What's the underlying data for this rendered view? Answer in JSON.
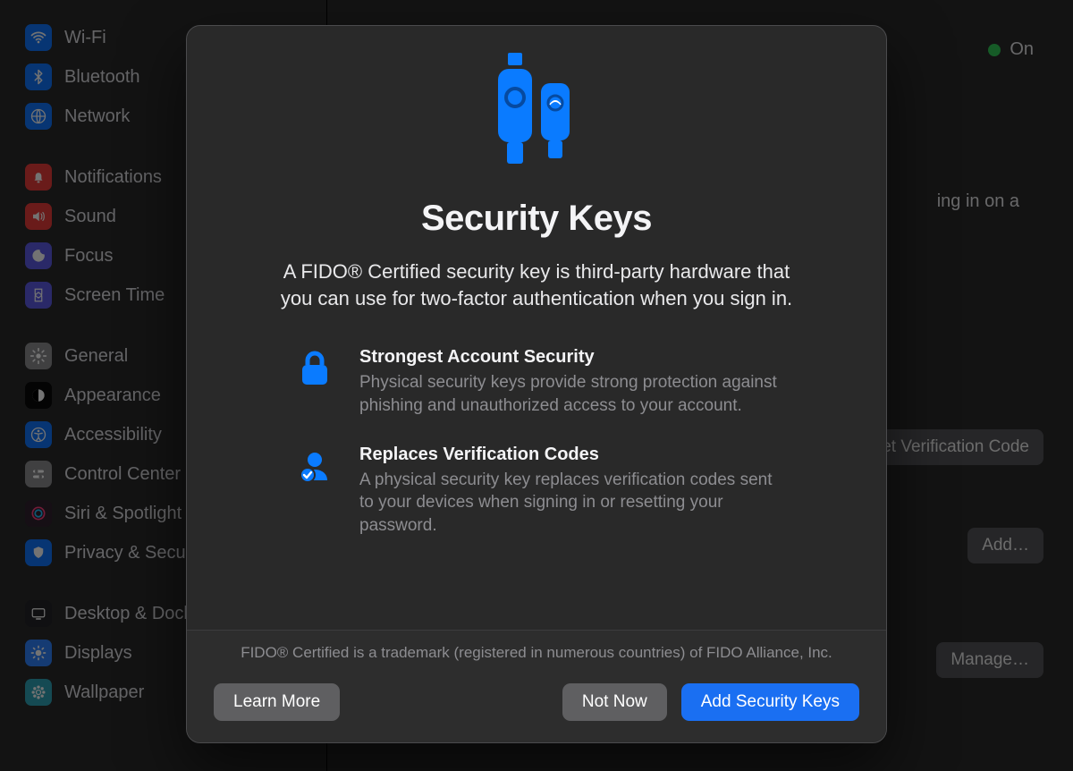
{
  "sidebar": {
    "items": [
      {
        "label": "Wi-Fi"
      },
      {
        "label": "Bluetooth"
      },
      {
        "label": "Network"
      },
      {
        "label": "Notifications"
      },
      {
        "label": "Sound"
      },
      {
        "label": "Focus"
      },
      {
        "label": "Screen Time"
      },
      {
        "label": "General"
      },
      {
        "label": "Appearance"
      },
      {
        "label": "Accessibility"
      },
      {
        "label": "Control Center"
      },
      {
        "label": "Siri & Spotlight"
      },
      {
        "label": "Privacy & Security"
      },
      {
        "label": "Desktop & Dock"
      },
      {
        "label": "Displays"
      },
      {
        "label": "Wallpaper"
      }
    ]
  },
  "main": {
    "on_label": "On",
    "bg_text_frag": "ing in on a",
    "btn_verification": "Get Verification Code",
    "btn_add": "Add…",
    "btn_manage": "Manage…"
  },
  "modal": {
    "title": "Security Keys",
    "description": "A FIDO® Certified security key is third-party hardware that you can use for two-factor authentication when you sign in.",
    "feature1_title": "Strongest Account Security",
    "feature1_body": "Physical security keys provide strong protection against phishing and unauthorized access to your account.",
    "feature2_title": "Replaces Verification Codes",
    "feature2_body": "A physical security key replaces verification codes sent to your devices when signing in or resetting your password.",
    "fine_print": "FIDO® Certified is a trademark (registered in numerous countries) of FIDO Alliance, Inc.",
    "btn_learn": "Learn More",
    "btn_notnow": "Not Now",
    "btn_add": "Add Security Keys"
  }
}
